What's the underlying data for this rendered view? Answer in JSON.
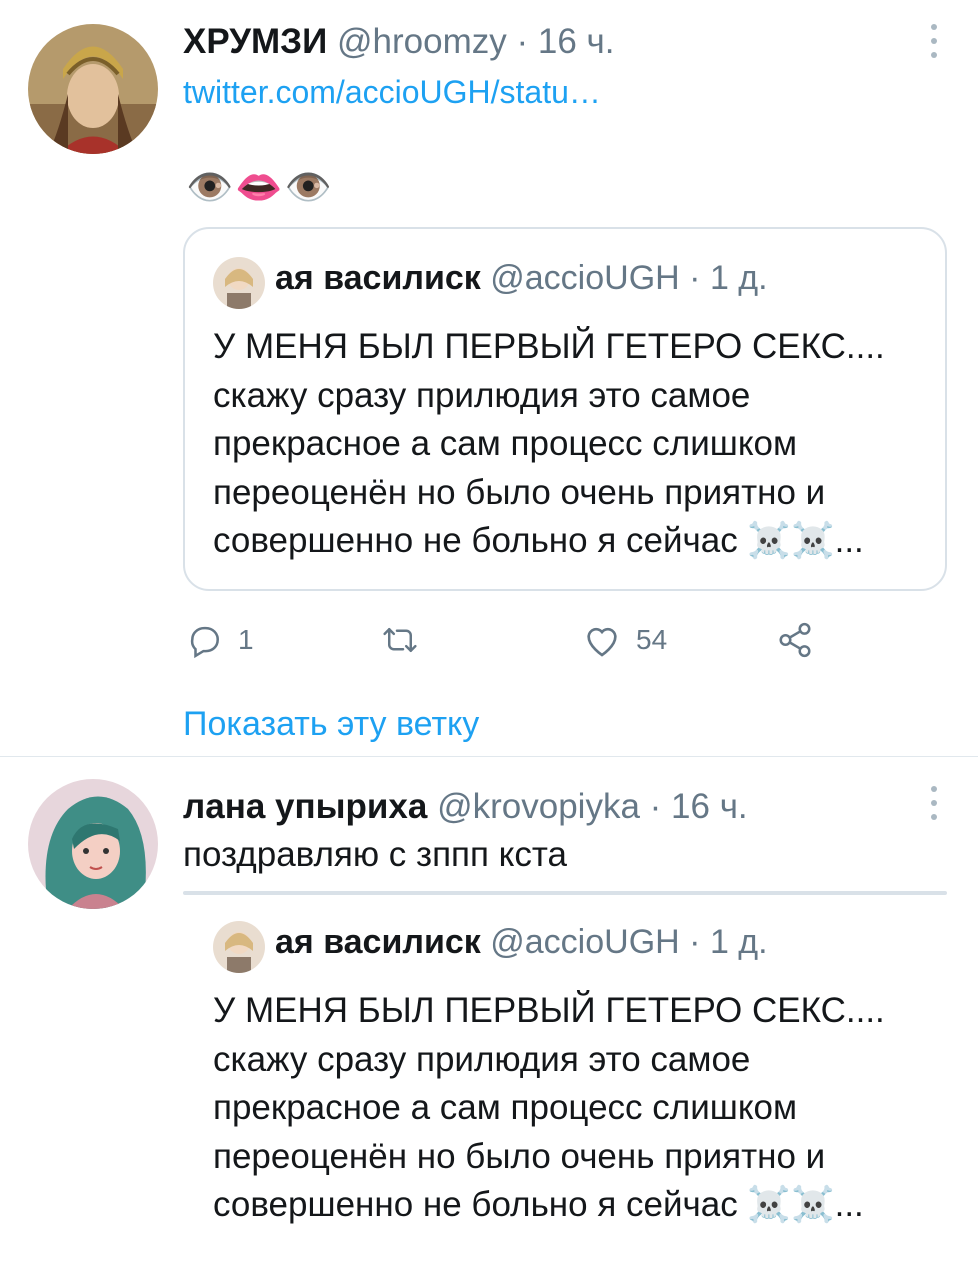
{
  "tweets": [
    {
      "name": "ХРУМЗИ",
      "handle": "@hroomzy",
      "separator": "·",
      "time": "16 ч.",
      "link_text": "twitter.com/accioUGH/statu…",
      "emoji": "👁️👄👁️",
      "quote": {
        "name": "ая василиск",
        "handle": "@accioUGH",
        "separator": "·",
        "time": "1 д.",
        "text": "У МЕНЯ БЫЛ ПЕРВЫЙ ГЕТЕРО СЕКС.... скажу сразу прилюдия это самое прекрасное а сам процесс слишком переоценён но было очень приятно и совершенно не больно я сейчас ☠️☠️..."
      },
      "actions": {
        "reply_count": "1",
        "retweet_count": "",
        "like_count": "54"
      },
      "show_thread": "Показать эту ветку"
    },
    {
      "name": "лана упыриха",
      "handle": "@krovopiyka",
      "separator": "·",
      "time": "16 ч.",
      "text": "поздравляю с зппп кста",
      "quote": {
        "name": "ая василиск",
        "handle": "@accioUGH",
        "separator": "·",
        "time": "1 д.",
        "text": "У МЕНЯ БЫЛ ПЕРВЫЙ ГЕТЕРО СЕКС.... скажу сразу прилюдия это самое прекрасное а сам процесс слишком переоценён но было очень приятно и совершенно не больно я сейчас ☠️☠️..."
      }
    }
  ],
  "colors": {
    "link": "#1da1f2",
    "secondary_text": "#657786",
    "border": "#d9e1e8"
  },
  "icons": [
    "more-vertical-icon",
    "reply-icon",
    "retweet-icon",
    "like-icon",
    "share-icon"
  ]
}
